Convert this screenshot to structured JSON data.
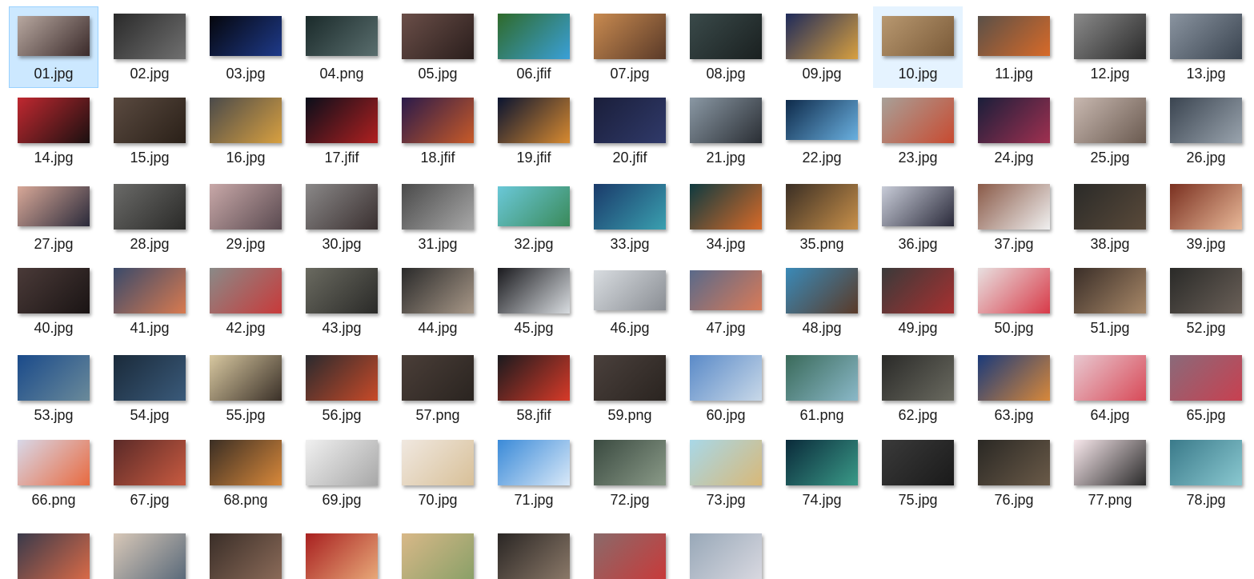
{
  "files": [
    {
      "name": "01.jpg",
      "colors": [
        "#b8a8a0",
        "#3a2a2a"
      ],
      "shape": "wide",
      "selected": true
    },
    {
      "name": "02.jpg",
      "colors": [
        "#2a2a2a",
        "#707070"
      ],
      "shape": "tall"
    },
    {
      "name": "03.jpg",
      "colors": [
        "#05060c",
        "#1e3a8a"
      ],
      "shape": "wide"
    },
    {
      "name": "04.png",
      "colors": [
        "#1a2a2a",
        "#5a6e6e"
      ],
      "shape": "wide"
    },
    {
      "name": "05.jpg",
      "colors": [
        "#6a4e48",
        "#2a1e1c"
      ],
      "shape": "tall"
    },
    {
      "name": "06.jfif",
      "colors": [
        "#2f6a2a",
        "#3aa0d8"
      ],
      "shape": "tall"
    },
    {
      "name": "07.jpg",
      "colors": [
        "#c88a50",
        "#5a3a28"
      ],
      "shape": "tall"
    },
    {
      "name": "08.jpg",
      "colors": [
        "#3a4a4a",
        "#1a2020"
      ],
      "shape": "tall"
    },
    {
      "name": "09.jpg",
      "colors": [
        "#1e2a5a",
        "#d8a040"
      ],
      "shape": "tall"
    },
    {
      "name": "10.jpg",
      "colors": [
        "#b89870",
        "#7a5a38"
      ],
      "shape": "wide",
      "hovered": true
    },
    {
      "name": "11.jpg",
      "colors": [
        "#5a5048",
        "#d86a28"
      ],
      "shape": "wide"
    },
    {
      "name": "12.jpg",
      "colors": [
        "#8a8a8a",
        "#2a2a2a"
      ],
      "shape": "tall"
    },
    {
      "name": "13.jpg",
      "colors": [
        "#8a94a0",
        "#3a4450"
      ],
      "shape": "tall"
    },
    {
      "name": "14.jpg",
      "colors": [
        "#c02830",
        "#1a1010"
      ],
      "shape": "tall"
    },
    {
      "name": "15.jpg",
      "colors": [
        "#5a4a40",
        "#2a2018"
      ],
      "shape": "tall"
    },
    {
      "name": "16.jpg",
      "colors": [
        "#4a4a4a",
        "#d8a040"
      ],
      "shape": "tall"
    },
    {
      "name": "17.jfif",
      "colors": [
        "#0a0e1a",
        "#b02020"
      ],
      "shape": "tall"
    },
    {
      "name": "18.jfif",
      "colors": [
        "#2a1a4a",
        "#c85a28"
      ],
      "shape": "tall"
    },
    {
      "name": "19.jfif",
      "colors": [
        "#0a1430",
        "#d88a30"
      ],
      "shape": "tall"
    },
    {
      "name": "20.jfif",
      "colors": [
        "#1a1e3a",
        "#303a6a"
      ],
      "shape": "tall"
    },
    {
      "name": "21.jpg",
      "colors": [
        "#8a98a4",
        "#2a2e34"
      ],
      "shape": "tall"
    },
    {
      "name": "22.jpg",
      "colors": [
        "#0e2a4a",
        "#6ab0e0"
      ],
      "shape": "wide"
    },
    {
      "name": "23.jpg",
      "colors": [
        "#a8a098",
        "#c84a30"
      ],
      "shape": "tall"
    },
    {
      "name": "24.jpg",
      "colors": [
        "#1a1e3a",
        "#a03050"
      ],
      "shape": "tall"
    },
    {
      "name": "25.jpg",
      "colors": [
        "#c8b8b0",
        "#6a5a50"
      ],
      "shape": "tall"
    },
    {
      "name": "26.jpg",
      "colors": [
        "#3a4450",
        "#9aa4ae"
      ],
      "shape": "tall"
    },
    {
      "name": "27.jpg",
      "colors": [
        "#d8a898",
        "#2a2a3a"
      ],
      "shape": "wide"
    },
    {
      "name": "28.jpg",
      "colors": [
        "#6a6a68",
        "#2a2a28"
      ],
      "shape": "tall"
    },
    {
      "name": "29.jpg",
      "colors": [
        "#c8a8a8",
        "#5a4a50"
      ],
      "shape": "tall"
    },
    {
      "name": "30.jpg",
      "colors": [
        "#8a8888",
        "#3a3030"
      ],
      "shape": "tall"
    },
    {
      "name": "31.jpg",
      "colors": [
        "#4a4a4a",
        "#a8a8a8"
      ],
      "shape": "tall"
    },
    {
      "name": "32.jpg",
      "colors": [
        "#6ac8d8",
        "#3a8a5a"
      ],
      "shape": "wide"
    },
    {
      "name": "33.jpg",
      "colors": [
        "#1a3a6a",
        "#3aa0b0"
      ],
      "shape": "tall"
    },
    {
      "name": "34.jpg",
      "colors": [
        "#0e3a40",
        "#d86a28"
      ],
      "shape": "tall"
    },
    {
      "name": "35.png",
      "colors": [
        "#3a2e24",
        "#c8904a"
      ],
      "shape": "tall"
    },
    {
      "name": "36.jpg",
      "colors": [
        "#c8ccd8",
        "#2a2a3a"
      ],
      "shape": "wide"
    },
    {
      "name": "37.jpg",
      "colors": [
        "#8a5a48",
        "#f0f0f0"
      ],
      "shape": "tall"
    },
    {
      "name": "38.jpg",
      "colors": [
        "#2a2a28",
        "#5a4a3a"
      ],
      "shape": "tall"
    },
    {
      "name": "39.jpg",
      "colors": [
        "#7a3020",
        "#e8b898"
      ],
      "shape": "tall"
    },
    {
      "name": "40.jpg",
      "colors": [
        "#4a3a38",
        "#1a1414"
      ],
      "shape": "tall"
    },
    {
      "name": "41.jpg",
      "colors": [
        "#3a4a6a",
        "#d87a50"
      ],
      "shape": "tall"
    },
    {
      "name": "42.jpg",
      "colors": [
        "#8a8a88",
        "#c83a3a"
      ],
      "shape": "tall"
    },
    {
      "name": "43.jpg",
      "colors": [
        "#6a6a60",
        "#2a2a28"
      ],
      "shape": "tall"
    },
    {
      "name": "44.jpg",
      "colors": [
        "#2a2a2a",
        "#a89888"
      ],
      "shape": "tall"
    },
    {
      "name": "45.jpg",
      "colors": [
        "#1a1a1e",
        "#d8dce0"
      ],
      "shape": "tall"
    },
    {
      "name": "46.jpg",
      "colors": [
        "#d8dce0",
        "#8a8e94"
      ],
      "shape": "wide"
    },
    {
      "name": "47.jpg",
      "colors": [
        "#5a6a8a",
        "#d87a58"
      ],
      "shape": "wide"
    },
    {
      "name": "48.jpg",
      "colors": [
        "#3a8ab8",
        "#5a3a28"
      ],
      "shape": "tall"
    },
    {
      "name": "49.jpg",
      "colors": [
        "#3a3a3a",
        "#a83030"
      ],
      "shape": "tall"
    },
    {
      "name": "50.jpg",
      "colors": [
        "#e8e0e0",
        "#d83a48"
      ],
      "shape": "tall"
    },
    {
      "name": "51.jpg",
      "colors": [
        "#3a2e28",
        "#a88868"
      ],
      "shape": "tall"
    },
    {
      "name": "52.jpg",
      "colors": [
        "#2a2a28",
        "#6a6058"
      ],
      "shape": "tall"
    },
    {
      "name": "53.jpg",
      "colors": [
        "#1a4a8a",
        "#6a8a9a"
      ],
      "shape": "tall"
    },
    {
      "name": "54.jpg",
      "colors": [
        "#1a2a3a",
        "#3a5a7a"
      ],
      "shape": "tall"
    },
    {
      "name": "55.jpg",
      "colors": [
        "#d8c8a0",
        "#3a3028"
      ],
      "shape": "tall"
    },
    {
      "name": "56.jpg",
      "colors": [
        "#2a2a2e",
        "#c84a28"
      ],
      "shape": "tall"
    },
    {
      "name": "57.png",
      "colors": [
        "#4a3e38",
        "#2a2420"
      ],
      "shape": "tall"
    },
    {
      "name": "58.jfif",
      "colors": [
        "#1a1a1e",
        "#d83a28"
      ],
      "shape": "tall"
    },
    {
      "name": "59.png",
      "colors": [
        "#4a403c",
        "#2a2420"
      ],
      "shape": "tall"
    },
    {
      "name": "60.jpg",
      "colors": [
        "#5a8ac8",
        "#c8d8e8"
      ],
      "shape": "tall"
    },
    {
      "name": "61.png",
      "colors": [
        "#3a6a5a",
        "#8ab8c8"
      ],
      "shape": "tall"
    },
    {
      "name": "62.jpg",
      "colors": [
        "#2a2a28",
        "#6a6a60"
      ],
      "shape": "tall"
    },
    {
      "name": "63.jpg",
      "colors": [
        "#1a3a7a",
        "#d8883a"
      ],
      "shape": "tall"
    },
    {
      "name": "64.jpg",
      "colors": [
        "#e8c8d0",
        "#d84a58"
      ],
      "shape": "tall"
    },
    {
      "name": "65.jpg",
      "colors": [
        "#8a6a7a",
        "#c84050"
      ],
      "shape": "tall"
    },
    {
      "name": "66.png",
      "colors": [
        "#d8d8e8",
        "#e86a40"
      ],
      "shape": "tall"
    },
    {
      "name": "67.jpg",
      "colors": [
        "#5a2a28",
        "#c85a40"
      ],
      "shape": "tall"
    },
    {
      "name": "68.png",
      "colors": [
        "#3a2e24",
        "#d8883a"
      ],
      "shape": "tall"
    },
    {
      "name": "69.jpg",
      "colors": [
        "#f0f0f0",
        "#a8a8a8"
      ],
      "shape": "tall"
    },
    {
      "name": "70.jpg",
      "colors": [
        "#f0e8e0",
        "#d8c098"
      ],
      "shape": "tall"
    },
    {
      "name": "71.jpg",
      "colors": [
        "#3a8ad8",
        "#d8e8f8"
      ],
      "shape": "tall"
    },
    {
      "name": "72.jpg",
      "colors": [
        "#3a4a40",
        "#8a9a88"
      ],
      "shape": "tall"
    },
    {
      "name": "73.jpg",
      "colors": [
        "#a8d8e8",
        "#d8b878"
      ],
      "shape": "tall"
    },
    {
      "name": "74.jpg",
      "colors": [
        "#0a2a3a",
        "#3a9a88"
      ],
      "shape": "tall"
    },
    {
      "name": "75.jpg",
      "colors": [
        "#3a3a3a",
        "#1a1a1a"
      ],
      "shape": "tall"
    },
    {
      "name": "76.jpg",
      "colors": [
        "#2a2824",
        "#6a5a48"
      ],
      "shape": "tall"
    },
    {
      "name": "77.png",
      "colors": [
        "#f8e8ec",
        "#2a2a2a"
      ],
      "shape": "tall"
    },
    {
      "name": "78.jpg",
      "colors": [
        "#3a7a8a",
        "#8ac8d0"
      ],
      "shape": "tall"
    },
    {
      "name": "",
      "colors": [
        "#3a3a4a",
        "#d86a48"
      ],
      "shape": "tall"
    },
    {
      "name": "",
      "colors": [
        "#d8c8b8",
        "#5a6a7a"
      ],
      "shape": "tall"
    },
    {
      "name": "",
      "colors": [
        "#3a2e28",
        "#8a6a58"
      ],
      "shape": "tall"
    },
    {
      "name": "",
      "colors": [
        "#a82020",
        "#e8a878"
      ],
      "shape": "tall"
    },
    {
      "name": "",
      "colors": [
        "#d8b888",
        "#8aa068"
      ],
      "shape": "tall"
    },
    {
      "name": "",
      "colors": [
        "#2a2624",
        "#8a7868"
      ],
      "shape": "tall"
    },
    {
      "name": "",
      "colors": [
        "#8a6a6a",
        "#c83a3a"
      ],
      "shape": "tall"
    },
    {
      "name": "",
      "colors": [
        "#98a8b8",
        "#d8d8e0"
      ],
      "shape": "tall"
    }
  ]
}
